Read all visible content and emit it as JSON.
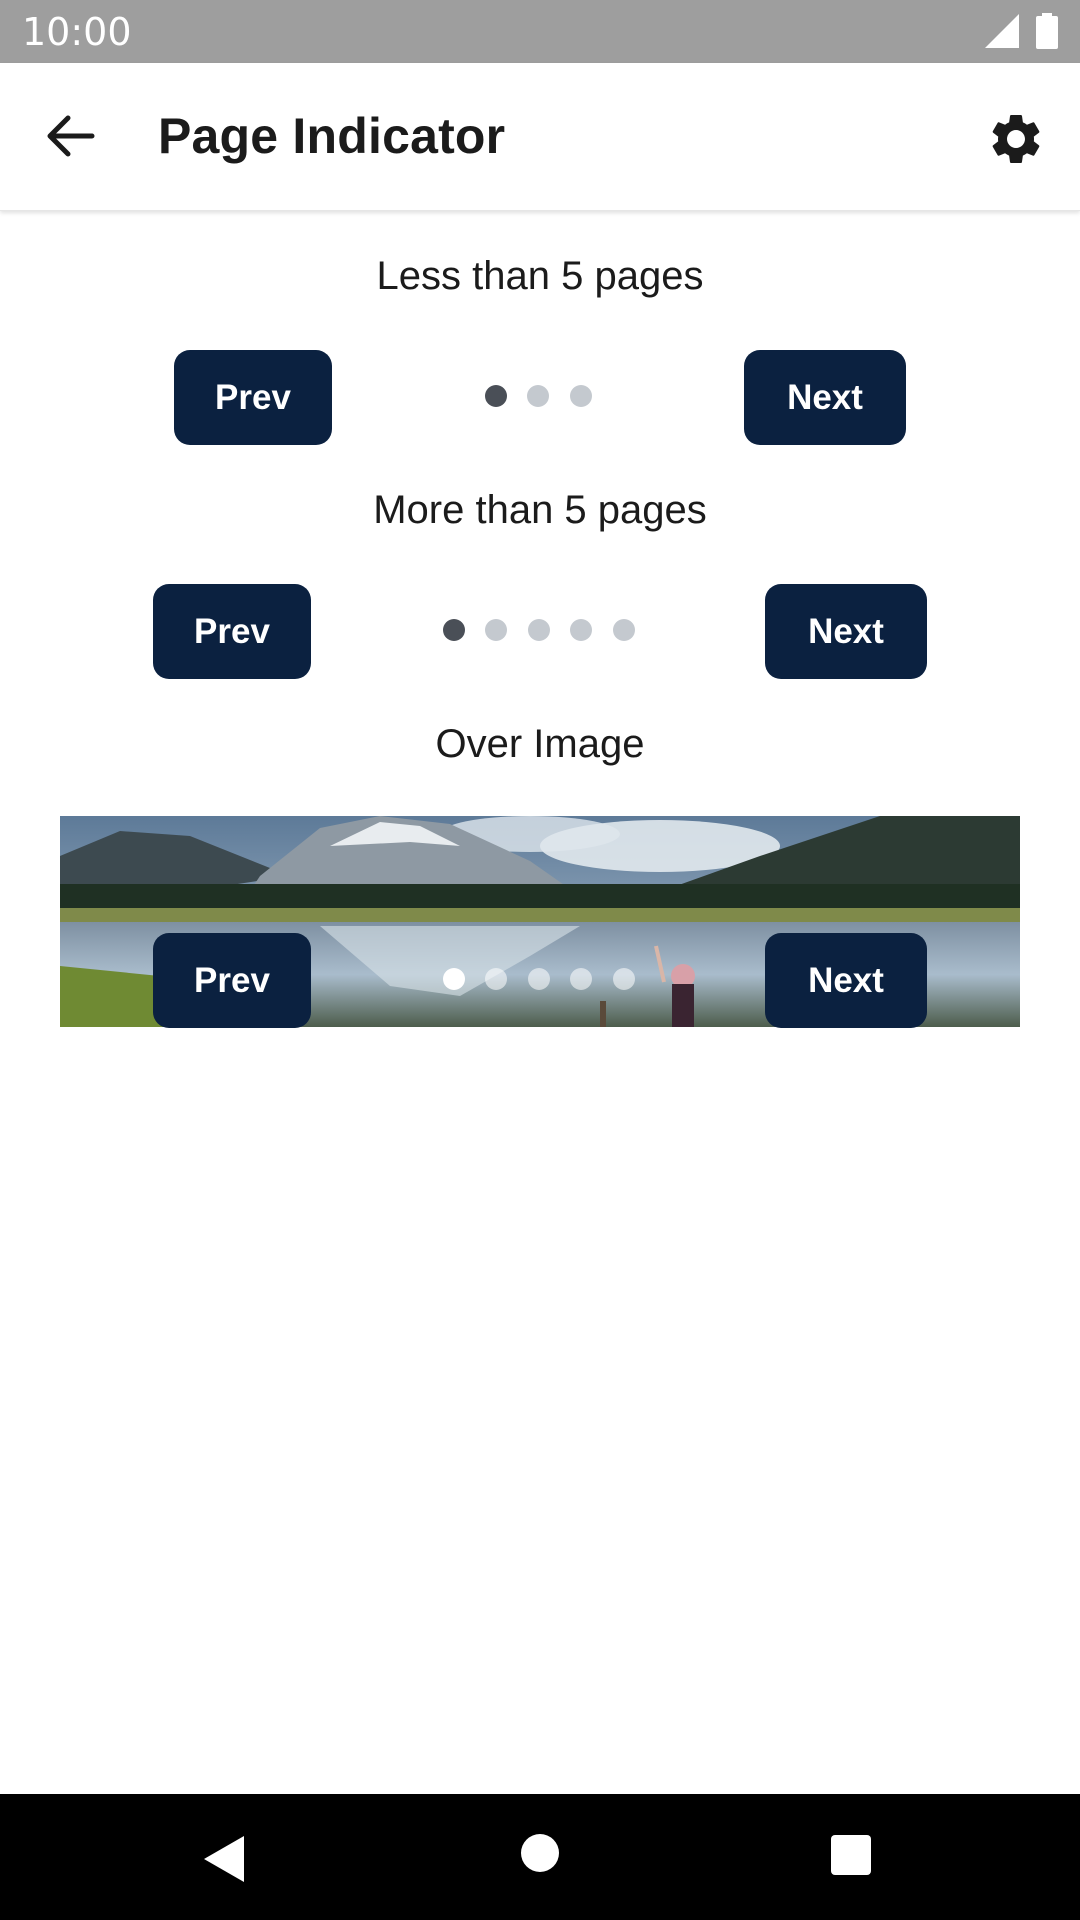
{
  "status_bar": {
    "time": "10:00"
  },
  "app_bar": {
    "title": "Page Indicator"
  },
  "sections": [
    {
      "label": "Less than 5 pages",
      "prev": "Prev",
      "next": "Next",
      "pages": 3,
      "active": 1
    },
    {
      "label": "More than 5 pages",
      "prev": "Prev",
      "next": "Next",
      "pages": 5,
      "active": 1
    },
    {
      "label": "Over Image",
      "prev": "Prev",
      "next": "Next",
      "pages": 5,
      "active": 1
    }
  ],
  "colors": {
    "button_bg": "#0b2140",
    "dot_active": "#4a4f57",
    "dot_inactive": "#c4c9cf",
    "status_bar": "#9e9e9e"
  },
  "icons": [
    "back-arrow-icon",
    "gear-icon",
    "signal-icon",
    "battery-icon",
    "nav-back-icon",
    "nav-home-icon",
    "nav-recents-icon"
  ]
}
